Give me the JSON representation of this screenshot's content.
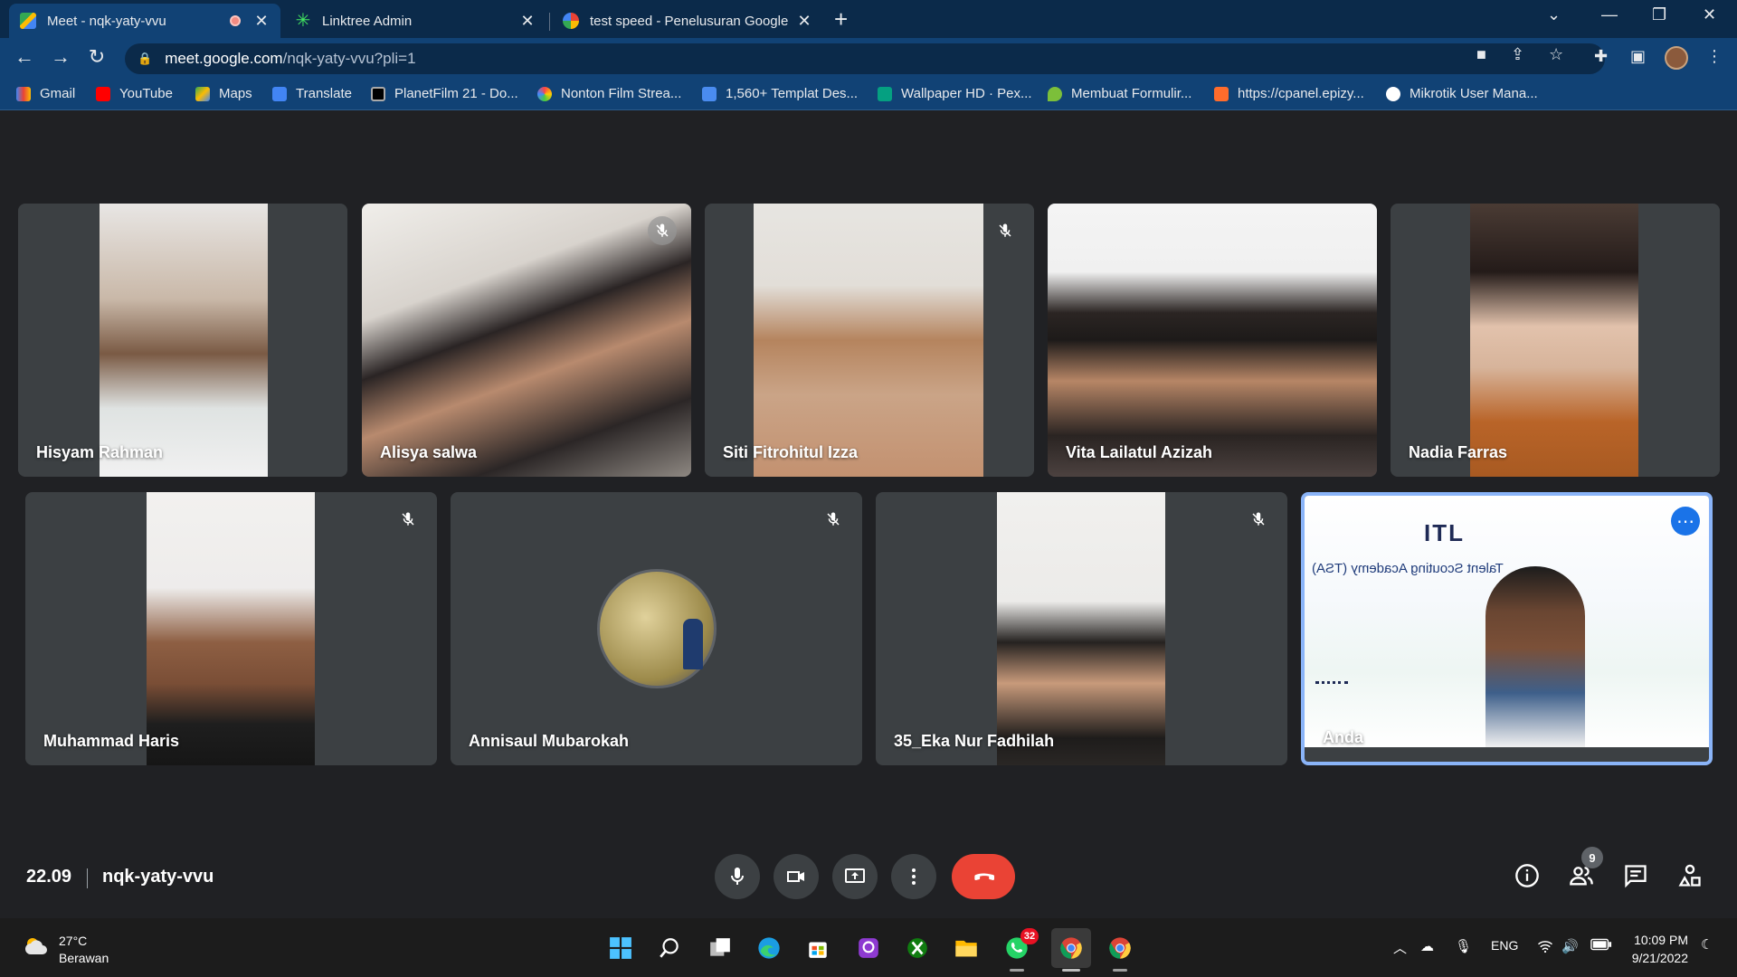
{
  "browser": {
    "tabs": [
      {
        "title": "Meet - nqk-yaty-vvu",
        "recording": true
      },
      {
        "title": "Linktree Admin"
      },
      {
        "title": "test speed - Penelusuran Google"
      }
    ],
    "url_host": "meet.google.com",
    "url_path": "/nqk-yaty-vvu?pli=1",
    "bookmarks": [
      "Gmail",
      "YouTube",
      "Maps",
      "Translate",
      "PlanetFilm 21 - Do...",
      "Nonton Film Strea...",
      "1,560+ Templat Des...",
      "Wallpaper HD · Pex...",
      "Membuat Formulir...",
      "https://cpanel.epizy...",
      "Mikrotik User Mana..."
    ]
  },
  "meet": {
    "participants": [
      {
        "name": "Hisyam Rahman",
        "muted": false
      },
      {
        "name": "Alisya salwa",
        "muted": true
      },
      {
        "name": "Siti Fitrohitul Izza",
        "muted": true
      },
      {
        "name": "Vita Lailatul Azizah",
        "muted": false
      },
      {
        "name": "Nadia Farras",
        "muted": false
      },
      {
        "name": "Muhammad Haris",
        "muted": true
      },
      {
        "name": "Annisaul Mubarokah",
        "muted": true
      },
      {
        "name": "35_Eka Nur Fadhilah",
        "muted": true
      },
      {
        "name": "Anda",
        "muted": false,
        "self": true
      }
    ],
    "self_banner": "Talent Scouting Academy (TSA)",
    "time": "22.09",
    "meeting_code": "nqk-yaty-vvu",
    "participant_count": "9",
    "colors": {
      "end_call": "#ea4335",
      "self_border": "#8ab4f8",
      "tile_bg": "#3c4043"
    }
  },
  "taskbar": {
    "temperature": "27°C",
    "weather": "Berawan",
    "whatsapp_badge": "32",
    "language": "ENG",
    "time": "10:09 PM",
    "date": "9/21/2022"
  }
}
